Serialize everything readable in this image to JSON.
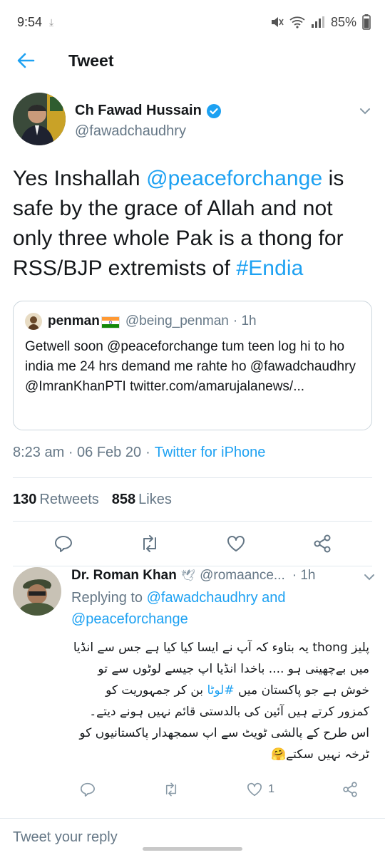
{
  "status_bar": {
    "time": "9:54",
    "battery": "85%"
  },
  "header": {
    "title": "Tweet",
    "back_icon": "back-arrow-icon"
  },
  "tweet": {
    "author_name": "Ch Fawad Hussain",
    "author_handle": "@fawadchaudhry",
    "text_1": "Yes Inshallah ",
    "mention": "@peaceforchange",
    "text_2": " is safe by the grace of Allah and not only three whole Pak is a thong for RSS/BJP extremists of ",
    "hashtag": "#Endia",
    "quote": {
      "name": "penman",
      "handle": "@being_penman",
      "time": "· 1h",
      "body": "Getwell soon @peaceforchange tum teen log hi to ho india me 24 hrs demand me rahte ho @fawadchaudhry @ImranKhanPTI twitter.com/amarujalanews/..."
    },
    "timestamp": "8:23 am · 06 Feb 20",
    "source": "Twitter for iPhone",
    "retweets_count": "130",
    "retweets_label": "Retweets",
    "likes_count": "858",
    "likes_label": "Likes"
  },
  "reply": {
    "name": "Dr. Roman Khan",
    "handle": "@romaance...",
    "time": "· 1h",
    "replying_prefix": "Replying to",
    "replying_1": "@fawadchaudhry",
    "replying_and": "and",
    "replying_2": "@peaceforchange",
    "urdu_1": "پلیز ",
    "urdu_thong": "thong",
    "urdu_2": " یہ بتاوء کہ آپ نے ایسا کیا کیا ہے جس سے انڈیا میں بےچھینی ہو .... باخدا انڈیا اپ جیسے لوٹوں سے تو خوش ہے جو پاکستان میں ",
    "urdu_tag": "#لوٹا",
    "urdu_3": " بن کر جمہوریت کو کمزور کرتے ہیں آئین کی بالدستی قائم نہیں ہونے دیتے۔ اس طرح کے پالشی ٹویٹ سے اپ سمجھدار پاکستانیوں کو ٹرخہ نہیں سکتے🤗",
    "likes_count": "1"
  },
  "reply_bar": {
    "placeholder": "Tweet your reply"
  },
  "colors": {
    "accent": "#1da1f2",
    "muted": "#657786",
    "text": "#14171a"
  }
}
